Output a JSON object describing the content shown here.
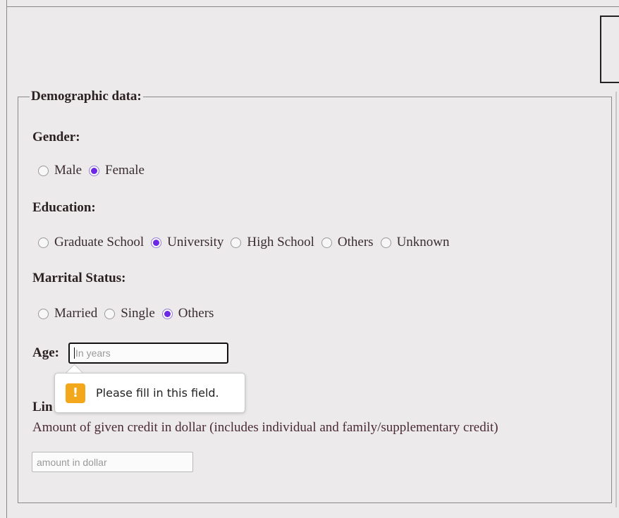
{
  "form": {
    "legend": "Demographic data:",
    "gender": {
      "label": "Gender:",
      "options": [
        {
          "label": "Male",
          "checked": false
        },
        {
          "label": "Female",
          "checked": true
        }
      ]
    },
    "education": {
      "label": "Education:",
      "options": [
        {
          "label": "Graduate School",
          "checked": false
        },
        {
          "label": "University",
          "checked": true
        },
        {
          "label": "High School",
          "checked": false
        },
        {
          "label": "Others",
          "checked": false
        },
        {
          "label": "Unknown",
          "checked": false
        }
      ]
    },
    "marital": {
      "label": "Marrital Status:",
      "options": [
        {
          "label": "Married",
          "checked": false
        },
        {
          "label": "Single",
          "checked": false
        },
        {
          "label": "Others",
          "checked": true
        }
      ]
    },
    "age": {
      "label": "Age:",
      "placeholder": "In years",
      "value": ""
    },
    "limit": {
      "label_visible": "Lin",
      "description": "Amount of given credit in dollar (includes individual and family/supplementary credit)",
      "placeholder": "amount in dollar",
      "value": ""
    },
    "validation": {
      "message": "Please fill in this field.",
      "icon": "warning-icon"
    }
  },
  "colors": {
    "radio_checked": "#6d28e6",
    "warning": "#f3a81c",
    "background": "#eceaea"
  }
}
